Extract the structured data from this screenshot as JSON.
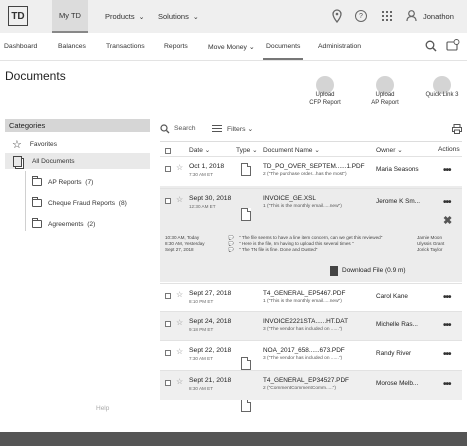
{
  "header": {
    "logo": "TD",
    "my_td": "My TD",
    "products": "Products",
    "solutions": "Solutions",
    "user": "Jonathon"
  },
  "subnav": [
    "Dashboard",
    "Balances",
    "Transactions",
    "Reports",
    "Move Money",
    "Documents",
    "Administration"
  ],
  "page": {
    "title": "Documents"
  },
  "quick_actions": [
    {
      "label1": "Upload",
      "label2": "CFP Report"
    },
    {
      "label1": "Upload",
      "label2": "AP Report"
    },
    {
      "label1": "Quick Link 3",
      "label2": ""
    }
  ],
  "toolbar": {
    "search": "Search",
    "filters": "Filters"
  },
  "categories": {
    "title": "Categories",
    "favorites": "Favorites",
    "all": "All Documents",
    "folders": [
      {
        "name": "AP Reports",
        "count": "(7)"
      },
      {
        "name": "Cheque Fraud Reports",
        "count": "(8)"
      },
      {
        "name": "Agreements",
        "count": "(2)"
      }
    ]
  },
  "table": {
    "headers": {
      "date": "Date",
      "type": "Type",
      "name": "Document Name",
      "owner": "Owner",
      "actions": "Actions"
    },
    "rows": [
      {
        "date": "Oct 1, 2018",
        "time": "7:30 AM ET",
        "name": "TD_PO_OVER_SEPTEM......1.PDF",
        "comment": "2 (\"The purchase order...has the most\")",
        "owner": "Maria Seasons"
      },
      {
        "date": "Sept 30, 2018",
        "time": "12:30 AM ET",
        "name": "INVOICE_GE.XSL",
        "comment": "1 (\"This is the monthly email.....new\")",
        "owner": "Jerome K Sm..."
      },
      {
        "date": "Sept 27, 2018",
        "time": "8:10 PM ET",
        "name": "T4_GENERAL_EP5467.PDF",
        "comment": "1 (\"This is the monthly email.....new\")",
        "owner": "Carol Kane"
      },
      {
        "date": "Sept 24, 2018",
        "time": "9:18 PM ET",
        "name": "INVOICE2221STA......HT.DAT",
        "comment": "3 (\"The vendor has included on ......\")",
        "owner": "Michelle Ras..."
      },
      {
        "date": "Sept 22, 2018",
        "time": "7:30 AM ET",
        "name": "NOA_2017_658......673.PDF",
        "comment": "3 (\"The vendor has included on ......\")",
        "owner": "Randy River"
      },
      {
        "date": "Sept 21, 2018",
        "time": "8:30 AM ET",
        "name": "T4_GENERAL_EP34527.PDF",
        "comment": "2 (\"CommentCommentComm.....\")",
        "owner": "Morose Melb..."
      }
    ]
  },
  "expanded": {
    "comments": [
      {
        "time": "10:30 AM, Today",
        "text": "\" The file seems to have a line item concern, can we get this reviewed\"",
        "author": "Jamie Moon"
      },
      {
        "time": "8:30 AM, Yesterday",
        "text": "\" Here is the file, Im having to upload this several times \"",
        "author": "Ulyssis Grant"
      },
      {
        "time": "Sept 27, 2018",
        "text": "\" The TN file is fine. Done and Dusted\"",
        "author": "Jorick Taylor"
      }
    ],
    "download": "Download File (0.9 m)"
  },
  "help": "Help"
}
